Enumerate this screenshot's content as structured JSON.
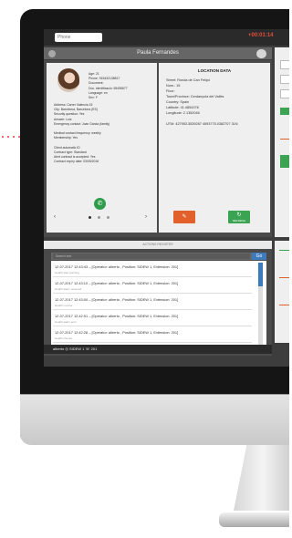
{
  "topbar": {
    "search_placeholder": "Phone",
    "clock": "+00:01:14"
  },
  "window": {
    "title": "Paula Fernandes"
  },
  "contact": {
    "lines": [
      "Age: 21",
      "Phone: 915432138817",
      "Document:",
      "Doc. identificació: 55498677",
      "Language: en",
      "Sex: F"
    ],
    "details": [
      "Address: Carrer Valencia 15",
      "City: Barcelona, Barcelona (ES)",
      "Security question: Yes",
      "Answer: Luis",
      "Emergency contact: Joan Garcia (family)",
      "",
      "Medical contact frequency: weekly",
      "Membership: Yes",
      "",
      "Client automatic ID",
      "Contract type: Standard",
      "Alert contract is accepted: Yes",
      "Contract expiry date: 03/05/2016"
    ]
  },
  "location": {
    "title": "LOCATION DATA",
    "lines": [
      "Street: Ronda de Can Felipó",
      "Num.: 15",
      "Floor:",
      "Town/Province: Cerdanyola del Vallès",
      "Country: Spain",
      "Latitude: 41.4854376",
      "Longitude: 2.1352046",
      "",
      "UTM: 427953.3539287 4593775.0382707 31N"
    ]
  },
  "actions": {
    "primary_icon": "✎",
    "secondary_icon": "↻",
    "secondary_label": "REFRESH"
  },
  "register": {
    "title": "ACTIONS REGISTER",
    "filter_placeholder": "Search text",
    "filter_button": "Go",
    "rows": [
      {
        "line1": "12-07-2017 12:43:43 – [Operator: alberto , Position: SIDEW 1, Extension: 201]",
        "line2": "Health alert warning"
      },
      {
        "line1": "12-07-2017 12:43:10 – [Operator: alberto , Position: SIDEW 1, Extension: 201]",
        "line2": "Health alarm received"
      },
      {
        "line1": "12-07-2017 12:43:00 – [Operator: alberto , Position: SIDEW 1, Extension: 201]",
        "line2": "Health monitor"
      },
      {
        "line1": "12-07-2017 12:42:51 – [Operator: alberto , Position: SIDEW 1, Extension: 201]",
        "line2": "Health alarm sent"
      },
      {
        "line1": "12-07-2017 12:42:28 – [Operator: alberto , Position: SIDEW 1, Extension: 201]",
        "line2": "Health checks"
      }
    ]
  },
  "footer": {
    "text": "alberto ◎ SIDEW 1 ☏ 201"
  },
  "colors": {
    "clock": "#e04d3a",
    "orange_button": "#e2612a",
    "green_button": "#3ba452",
    "blue_button": "#3d7bbd"
  }
}
